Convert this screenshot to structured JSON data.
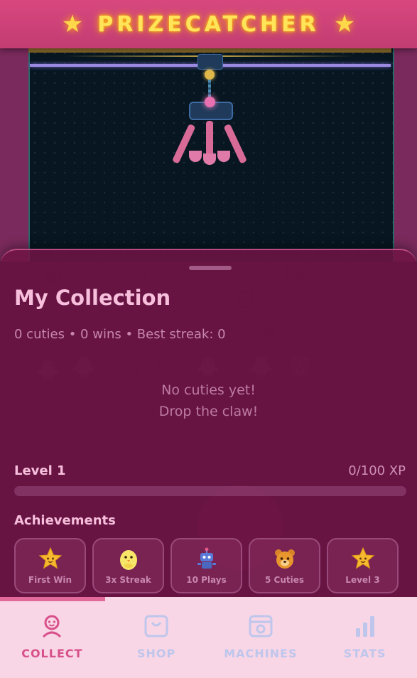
{
  "header": {
    "title": "PRIZECATCHER",
    "left_icon": "star-icon",
    "right_icon": "star-icon",
    "accent": "#ffe45a"
  },
  "collection": {
    "title": "My Collection",
    "stats": "0 cuties • 0 wins • Best streak: 0",
    "empty_line1": "No cuties yet!",
    "empty_line2": "Drop the claw!"
  },
  "level": {
    "label": "Level 1",
    "xp": "0/100 XP",
    "progress": 0
  },
  "achievements": {
    "title": "Achievements",
    "items": [
      {
        "label": "First Win",
        "icon": "star-icon"
      },
      {
        "label": "3x Streak",
        "icon": "chick-icon"
      },
      {
        "label": "10 Plays",
        "icon": "robot-icon"
      },
      {
        "label": "5 Cuties",
        "icon": "bear-icon"
      },
      {
        "label": "Level 3",
        "icon": "star-icon"
      }
    ]
  },
  "nav": {
    "items": [
      {
        "label": "COLLECT",
        "icon": "face-icon",
        "active": true
      },
      {
        "label": "SHOP",
        "icon": "bag-icon",
        "active": false
      },
      {
        "label": "MACHINES",
        "icon": "machine-icon",
        "active": false
      },
      {
        "label": "STATS",
        "icon": "bar-chart-icon",
        "active": false
      }
    ]
  }
}
